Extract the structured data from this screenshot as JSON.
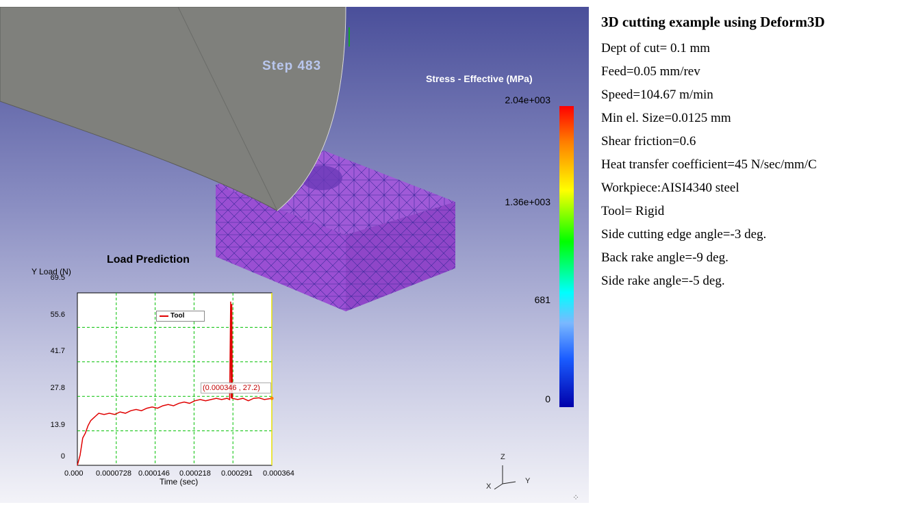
{
  "viewport": {
    "step_label": "Step 483",
    "legend": {
      "title": "Stress - Effective (MPa)",
      "ticks": [
        "2.04e+003",
        "1.36e+003",
        "681",
        "0"
      ]
    },
    "axes_triad": {
      "z": "Z",
      "y": "Y",
      "x": "X"
    },
    "colors": {
      "workpiece": "#a05ad8",
      "tool": "#7f807c",
      "mesh_line": "#3a2a9a"
    }
  },
  "chart_data": {
    "type": "line",
    "title": "Load Prediction",
    "ylabel": "Y Load (N)",
    "xlabel": "Time (sec)",
    "ylim": [
      0,
      69.5
    ],
    "xlim": [
      0,
      0.000364
    ],
    "yticks": [
      "69.5",
      "55.6",
      "41.7",
      "27.8",
      "13.9",
      "0"
    ],
    "xticks": [
      "0.000",
      "0.0000728",
      "0.000146",
      "0.000218",
      "0.000291",
      "0.000364"
    ],
    "grid": true,
    "series": [
      {
        "name": "Tool",
        "color": "#e00000",
        "x": [
          0,
          5e-06,
          1e-05,
          1.5e-05,
          2e-05,
          2.5e-05,
          3e-05,
          3.5e-05,
          4e-05,
          5e-05,
          6e-05,
          7e-05,
          8e-05,
          9e-05,
          0.0001,
          0.00011,
          0.00012,
          0.00013,
          0.00014,
          0.00015,
          0.00016,
          0.00017,
          0.00018,
          0.00019,
          0.0002,
          0.00021,
          0.00022,
          0.00023,
          0.00024,
          0.00025,
          0.00026,
          0.00027,
          0.00028,
          0.000285,
          0.000287,
          0.000288,
          0.000289,
          0.00029,
          0.0003,
          0.00031,
          0.00032,
          0.00033,
          0.00034,
          0.00035,
          0.000364
        ],
        "y": [
          0,
          4,
          11,
          13,
          16,
          18,
          19,
          20,
          21,
          20.5,
          21,
          20.5,
          21.5,
          21,
          22,
          22.5,
          22,
          23,
          23.5,
          23,
          24,
          24.5,
          24,
          25,
          25.5,
          25,
          26,
          26.5,
          26,
          26.5,
          27,
          26.5,
          27,
          26.5,
          66,
          27,
          65,
          27,
          26.5,
          27,
          26,
          27,
          27.2,
          26.5,
          27
        ]
      }
    ],
    "annotation": "(0.000346 , 27.2)"
  },
  "info": {
    "title": "3D cutting example using Deform3D",
    "lines": [
      "Dept of cut= 0.1 mm",
      "Feed=0.05 mm/rev",
      "Speed=104.67  m/min",
      "Min el. Size=0.0125 mm",
      "Shear friction=0.6",
      "Heat transfer coefficient=45 N/sec/mm/C",
      "Workpiece:AISI4340 steel",
      "Tool= Rigid",
      "Side cutting edge angle=-3 deg.",
      "Back rake angle=-9 deg.",
      "Side rake angle=-5 deg."
    ]
  }
}
